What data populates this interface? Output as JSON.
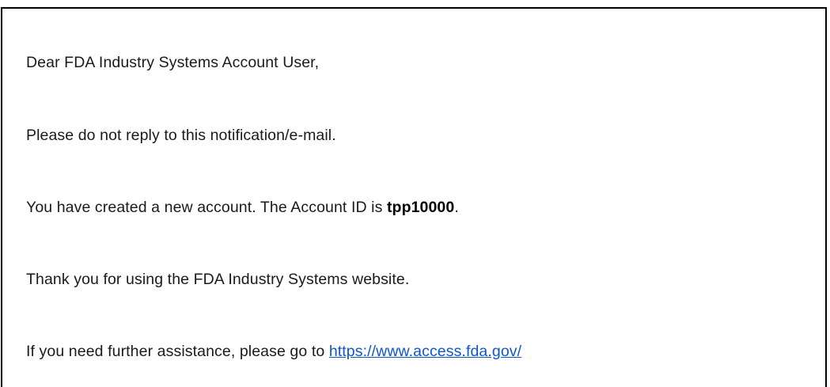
{
  "email": {
    "greeting": "Dear FDA Industry Systems Account User,",
    "do_not_reply": "Please do not reply to this notification/e-mail.",
    "account_created_prefix": "You have created a new account. The Account ID is ",
    "account_id": "tpp10000",
    "account_created_suffix": ".",
    "thanks": "Thank you for using the FDA Industry Systems website.",
    "assistance_prefix": "If you need further assistance, please go to ",
    "assistance_link": "https://www.access.fda.gov/"
  },
  "colors": {
    "link": "#1155cc",
    "text": "#1a1a1a",
    "border": "#000000"
  }
}
